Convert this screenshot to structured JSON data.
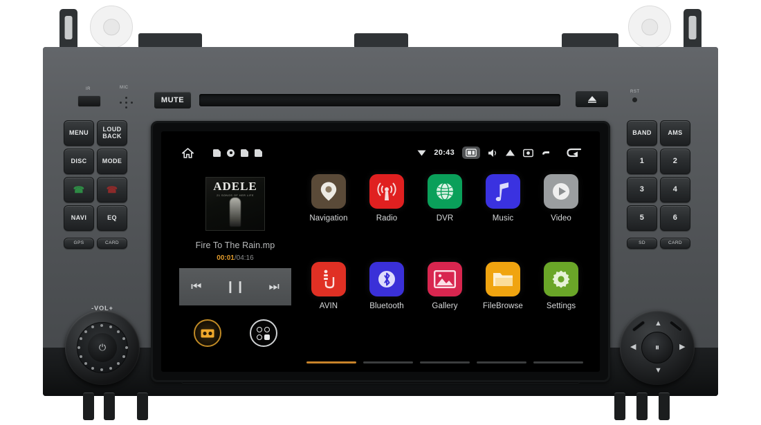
{
  "device": {
    "name": "2-DIN Android Car Head Unit",
    "brand_labels": {
      "mic": "MIC",
      "ir": "IR",
      "reset": "RST",
      "volume": "-VOL+"
    }
  },
  "front_panel": {
    "mute_button": "MUTE",
    "eject_icon": "eject-triangle-icon",
    "left_keys": [
      {
        "label": "MENU",
        "name": "menu-button"
      },
      {
        "label": "LOUD\nBACK",
        "line1": "LOUD",
        "line2": "BACK",
        "name": "loud-back-button"
      },
      {
        "label": "DISC",
        "name": "disc-button"
      },
      {
        "label": "MODE",
        "name": "mode-button"
      },
      {
        "label": "",
        "name": "call-answer-button",
        "icon": "phone-green-icon"
      },
      {
        "label": "",
        "name": "call-end-button",
        "icon": "phone-red-icon"
      },
      {
        "label": "NAVI",
        "name": "navi-button"
      },
      {
        "label": "EQ",
        "name": "eq-button"
      }
    ],
    "left_slots": [
      {
        "label": "GPS",
        "name": "gps-slot"
      },
      {
        "label": "CARD",
        "name": "card-slot-left"
      }
    ],
    "right_keys": [
      {
        "label": "BAND",
        "name": "band-button"
      },
      {
        "label": "AMS",
        "name": "ams-button"
      },
      {
        "label": "1",
        "name": "preset-1-button"
      },
      {
        "label": "2",
        "name": "preset-2-button"
      },
      {
        "label": "3",
        "name": "preset-3-button"
      },
      {
        "label": "4",
        "name": "preset-4-button"
      },
      {
        "label": "5",
        "name": "preset-5-button"
      },
      {
        "label": "6",
        "name": "preset-6-button"
      }
    ],
    "right_slots": [
      {
        "label": "SD",
        "name": "sd-slot"
      },
      {
        "label": "CARD",
        "name": "card-slot-right"
      }
    ],
    "volume_knob": {
      "label": "-VOL+",
      "center_icon": "power-icon"
    },
    "dpad": {
      "center_icon": "play-pause-icon",
      "up": "▲",
      "down": "▼",
      "left": "◀",
      "right": "▶"
    }
  },
  "screen": {
    "status_bar": {
      "home_icon": "home-icon",
      "storage_icons": [
        "sd-card-icon",
        "disc-icon",
        "usb1-icon",
        "usb2-icon"
      ],
      "wifi_icon": "wifi-icon",
      "time": "20:43",
      "active_icon": "screen-mirror-icon",
      "volume_icon": "volume-icon",
      "home_triangle_icon": "home-triangle-icon",
      "screenshot_icon": "screenshot-icon",
      "apps_icon": "recent-apps-icon",
      "back_icon": "back-arrow-icon"
    },
    "music_widget": {
      "album_artist": "ADELE",
      "album_subtitle": "21 SONGS OF HER LIFE",
      "track_title": "Fire To The Rain.mp",
      "time_current": "00:01",
      "time_separator": "/",
      "time_total": "04:16",
      "controls": {
        "prev": "previous-track-icon",
        "playpause": "pause-icon",
        "next": "next-track-icon"
      },
      "shortcut_buttons": [
        {
          "name": "radio-shortcut-button",
          "icon": "cassette-icon"
        },
        {
          "name": "all-apps-button",
          "icon": "apps-grid-icon"
        }
      ]
    },
    "apps": [
      {
        "label": "Navigation",
        "icon": "map-pin-icon",
        "color": "#5a4a38",
        "name": "app-navigation"
      },
      {
        "label": "Radio",
        "icon": "radio-waves-icon",
        "color": "#e02020",
        "name": "app-radio"
      },
      {
        "label": "DVR",
        "icon": "globe-icon",
        "color": "#0aa05a",
        "name": "app-dvr"
      },
      {
        "label": "Music",
        "icon": "music-note-icon",
        "color": "#3a32e0",
        "name": "app-music"
      },
      {
        "label": "Video",
        "icon": "play-circle-icon",
        "color": "#9b9ea0",
        "name": "app-video"
      },
      {
        "label": "AVIN",
        "icon": "avin-plug-icon",
        "color": "#e03024",
        "name": "app-avin"
      },
      {
        "label": "Bluetooth",
        "icon": "bluetooth-icon",
        "color": "#3a30d8",
        "name": "app-bluetooth"
      },
      {
        "label": "Gallery",
        "icon": "photo-icon",
        "color": "#d8264f",
        "name": "app-gallery"
      },
      {
        "label": "FileBrowse",
        "icon": "folder-icon",
        "color": "#f0a410",
        "name": "app-filebrowse"
      },
      {
        "label": "Settings",
        "icon": "gear-icon",
        "color": "#6aa628",
        "name": "app-settings"
      }
    ],
    "page_indicator": {
      "total": 5,
      "active": 1,
      "active_color": "#c8832a"
    }
  }
}
